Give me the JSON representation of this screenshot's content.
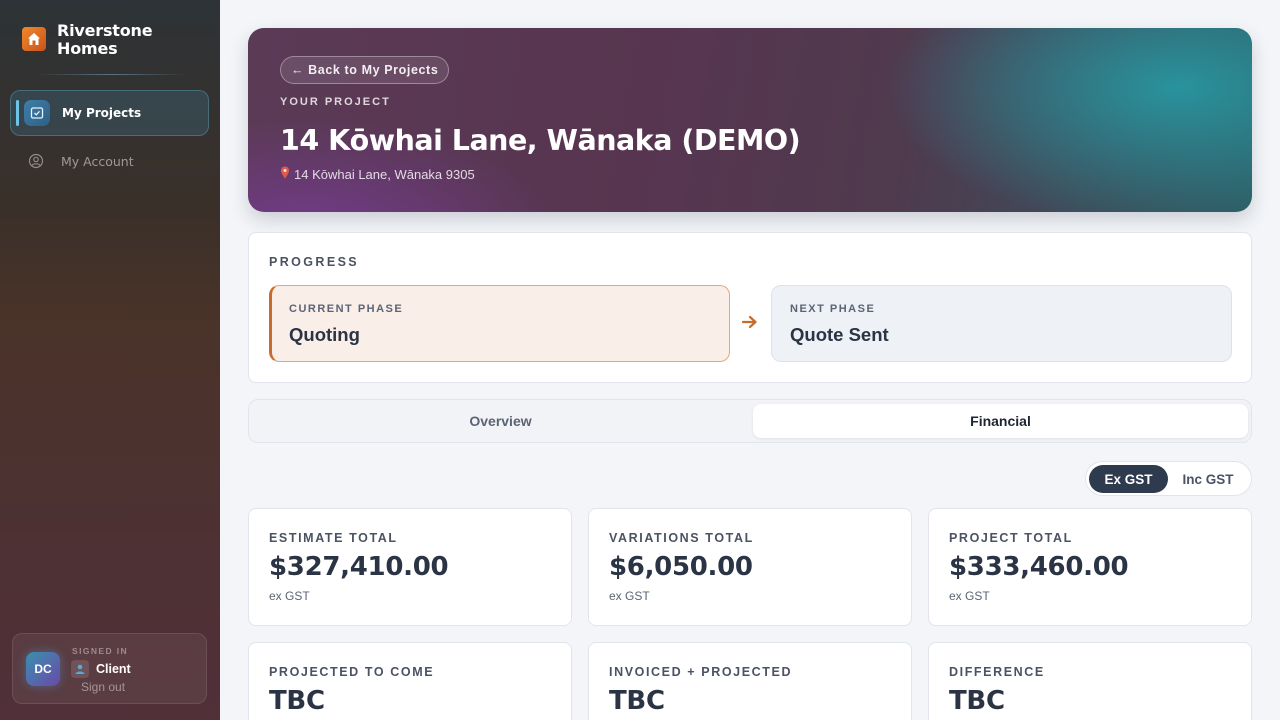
{
  "brand": {
    "name": "Riverstone Homes",
    "logo_icon": "house-icon",
    "accent": "#e8782a"
  },
  "nav": [
    {
      "label": "My Projects",
      "icon": "checklist-folder-icon",
      "active": true
    },
    {
      "label": "My Account",
      "icon": "user-circle-icon",
      "active": false
    }
  ],
  "user": {
    "initials": "DC",
    "signed_in_label": "SIGNED IN",
    "role": "Client",
    "signout_label": "Sign out"
  },
  "hero": {
    "back_label": "← Back to My Projects",
    "eyebrow": "YOUR PROJECT",
    "title": "14 Kōwhai Lane, Wānaka (DEMO)",
    "address": "14 Kōwhai Lane, Wānaka 9305"
  },
  "progress": {
    "section_label": "PROGRESS",
    "current": {
      "label": "CURRENT PHASE",
      "value": "Quoting"
    },
    "next": {
      "label": "NEXT PHASE",
      "value": "Quote Sent"
    }
  },
  "tabs": [
    {
      "label": "Overview",
      "active": false
    },
    {
      "label": "Financial",
      "active": true
    }
  ],
  "gst_toggle": {
    "ex_label": "Ex GST",
    "inc_label": "Inc GST",
    "selected": "Ex GST"
  },
  "stats": [
    {
      "label": "ESTIMATE TOTAL",
      "value": "$327,410.00",
      "sub": "ex GST"
    },
    {
      "label": "VARIATIONS TOTAL",
      "value": "$6,050.00",
      "sub": "ex GST"
    },
    {
      "label": "PROJECT TOTAL",
      "value": "$333,460.00",
      "sub": "ex GST"
    },
    {
      "label": "PROJECTED TO COME",
      "value": "TBC",
      "sub": ""
    },
    {
      "label": "INVOICED + PROJECTED",
      "value": "TBC",
      "sub": ""
    },
    {
      "label": "DIFFERENCE",
      "value": "TBC",
      "sub": ""
    }
  ]
}
